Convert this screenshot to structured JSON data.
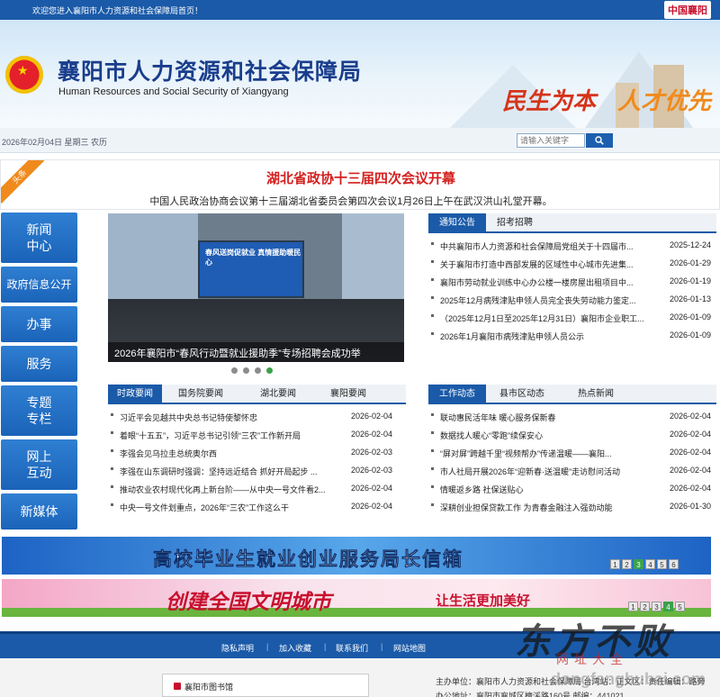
{
  "topbar": {
    "welcome": "欢迎您进入襄阳市人力资源和社会保障局首页！",
    "logo_text": "中国襄阳"
  },
  "header": {
    "title": "襄阳市人力资源和社会保障局",
    "subtitle": "Human Resources and Social Security of Xiangyang",
    "slogan_1": "民生为本",
    "slogan_2": "人才优先"
  },
  "datebar": {
    "date": "2026年02月04日 星期三 农历"
  },
  "search": {
    "placeholder": "请输入关键字",
    "icon": "search-icon"
  },
  "headline": {
    "ribbon": "头条",
    "title": "湖北省政协十三届四次会议开幕",
    "summary": "中国人民政治协商会议第十三届湖北省委员会第四次会议1月26日上午在武汉洪山礼堂开幕。"
  },
  "leftnav": [
    {
      "label": "新闻中心"
    },
    {
      "label": "政府信息公开"
    },
    {
      "label": "办事"
    },
    {
      "label": "服务"
    },
    {
      "label": "专题专栏"
    },
    {
      "label": "网上互动"
    },
    {
      "label": "新媒体"
    }
  ],
  "slideshow": {
    "caption": "2026年襄阳市“春风行动暨就业援助季”专场招聘会成功举",
    "screen_text": "春风送岗促就业 真情援助暖民心",
    "dots": 4,
    "active_dot": 4
  },
  "notice_panel": {
    "tabs": [
      "通知公告",
      "招考招聘"
    ],
    "active_tab": 0,
    "items": [
      {
        "title": "中共襄阳市人力资源和社会保障局党组关于十四届市...",
        "date": "2025-12-24"
      },
      {
        "title": "关于襄阳市打造中西部发展的区域性中心城市先进集...",
        "date": "2026-01-29"
      },
      {
        "title": "襄阳市劳动就业训练中心办公楼一楼房屋出租项目中...",
        "date": "2026-01-19"
      },
      {
        "title": "2025年12月病残津贴申领人员完全丧失劳动能力鉴定...",
        "date": "2026-01-13"
      },
      {
        "title": "（2025年12月1日至2025年12月31日）襄阳市企业职工...",
        "date": "2026-01-09"
      },
      {
        "title": "2026年1月襄阳市病残津贴申领人员公示",
        "date": "2026-01-09"
      }
    ]
  },
  "news_panel": {
    "tabs": [
      "时政要闻",
      "国务院要闻",
      "湖北要闻",
      "襄阳要闻"
    ],
    "active_tab": 0,
    "items": [
      {
        "title": "习近平会见越共中央总书记特使黎怀忠",
        "date": "2026-02-04"
      },
      {
        "title": "着眼“十五五”，习近平总书记引领“三农”工作新开局",
        "date": "2026-02-04"
      },
      {
        "title": "李强会见乌拉圭总统奥尔西",
        "date": "2026-02-03"
      },
      {
        "title": "李强在山东调研时强调：坚持远近结合 抓好开局起步 ...",
        "date": "2026-02-03"
      },
      {
        "title": "推动农业农村现代化再上新台阶——从中央一号文件看2...",
        "date": "2026-02-04"
      },
      {
        "title": "中央一号文件划重点，2026年“三农”工作这么干",
        "date": "2026-02-04"
      }
    ]
  },
  "work_panel": {
    "tabs": [
      "工作动态",
      "县市区动态",
      "热点新闻"
    ],
    "active_tab": 0,
    "items": [
      {
        "title": "联动惠民活年味 暖心服务保新春",
        "date": "2026-02-04"
      },
      {
        "title": "数据找人暖心“零跑”续保安心",
        "date": "2026-02-04"
      },
      {
        "title": "“屏对屏”跨越千里“视频帮办”传递温暖——襄阳...",
        "date": "2026-02-04"
      },
      {
        "title": "市人社局开展2026年“迎新春·送温暖”走访慰问活动",
        "date": "2026-02-04"
      },
      {
        "title": "情暖返乡路 社保送贴心",
        "date": "2026-02-04"
      },
      {
        "title": "深耕创业担保贷款工作 为青春金融注入强劲动能",
        "date": "2026-01-30"
      }
    ]
  },
  "promo_1": {
    "text": "高校毕业生就业创业服务局长信箱",
    "pages": [
      "1",
      "2",
      "3",
      "4",
      "5",
      "6"
    ],
    "active_page": 2
  },
  "promo_2": {
    "text_1": "创建全国文明城市",
    "text_2": "让生活更加美好",
    "pages": [
      "1",
      "2",
      "3",
      "4",
      "5"
    ],
    "active_page": 3
  },
  "footer_nav": [
    "隐私声明",
    "加入收藏",
    "联系我们",
    "网站地图"
  ],
  "footer": {
    "library": "襄阳市图书馆",
    "sponsor": "主办单位：襄阳市人力资源和社会保障局 台湾站：正文区：责任编辑：路旁",
    "address": "办公地址：襄阳市襄城区檀溪路160号 邮编：441021"
  },
  "watermark": {
    "line_1": "东方不败",
    "line_2": "网址大全",
    "line_3": "dongfangbubai.com"
  },
  "colors": {
    "brand_blue": "#1a5aa8",
    "headline_red": "#d4201f",
    "accent_orange": "#f08a1c",
    "active_dot_green": "#3aa24a"
  }
}
